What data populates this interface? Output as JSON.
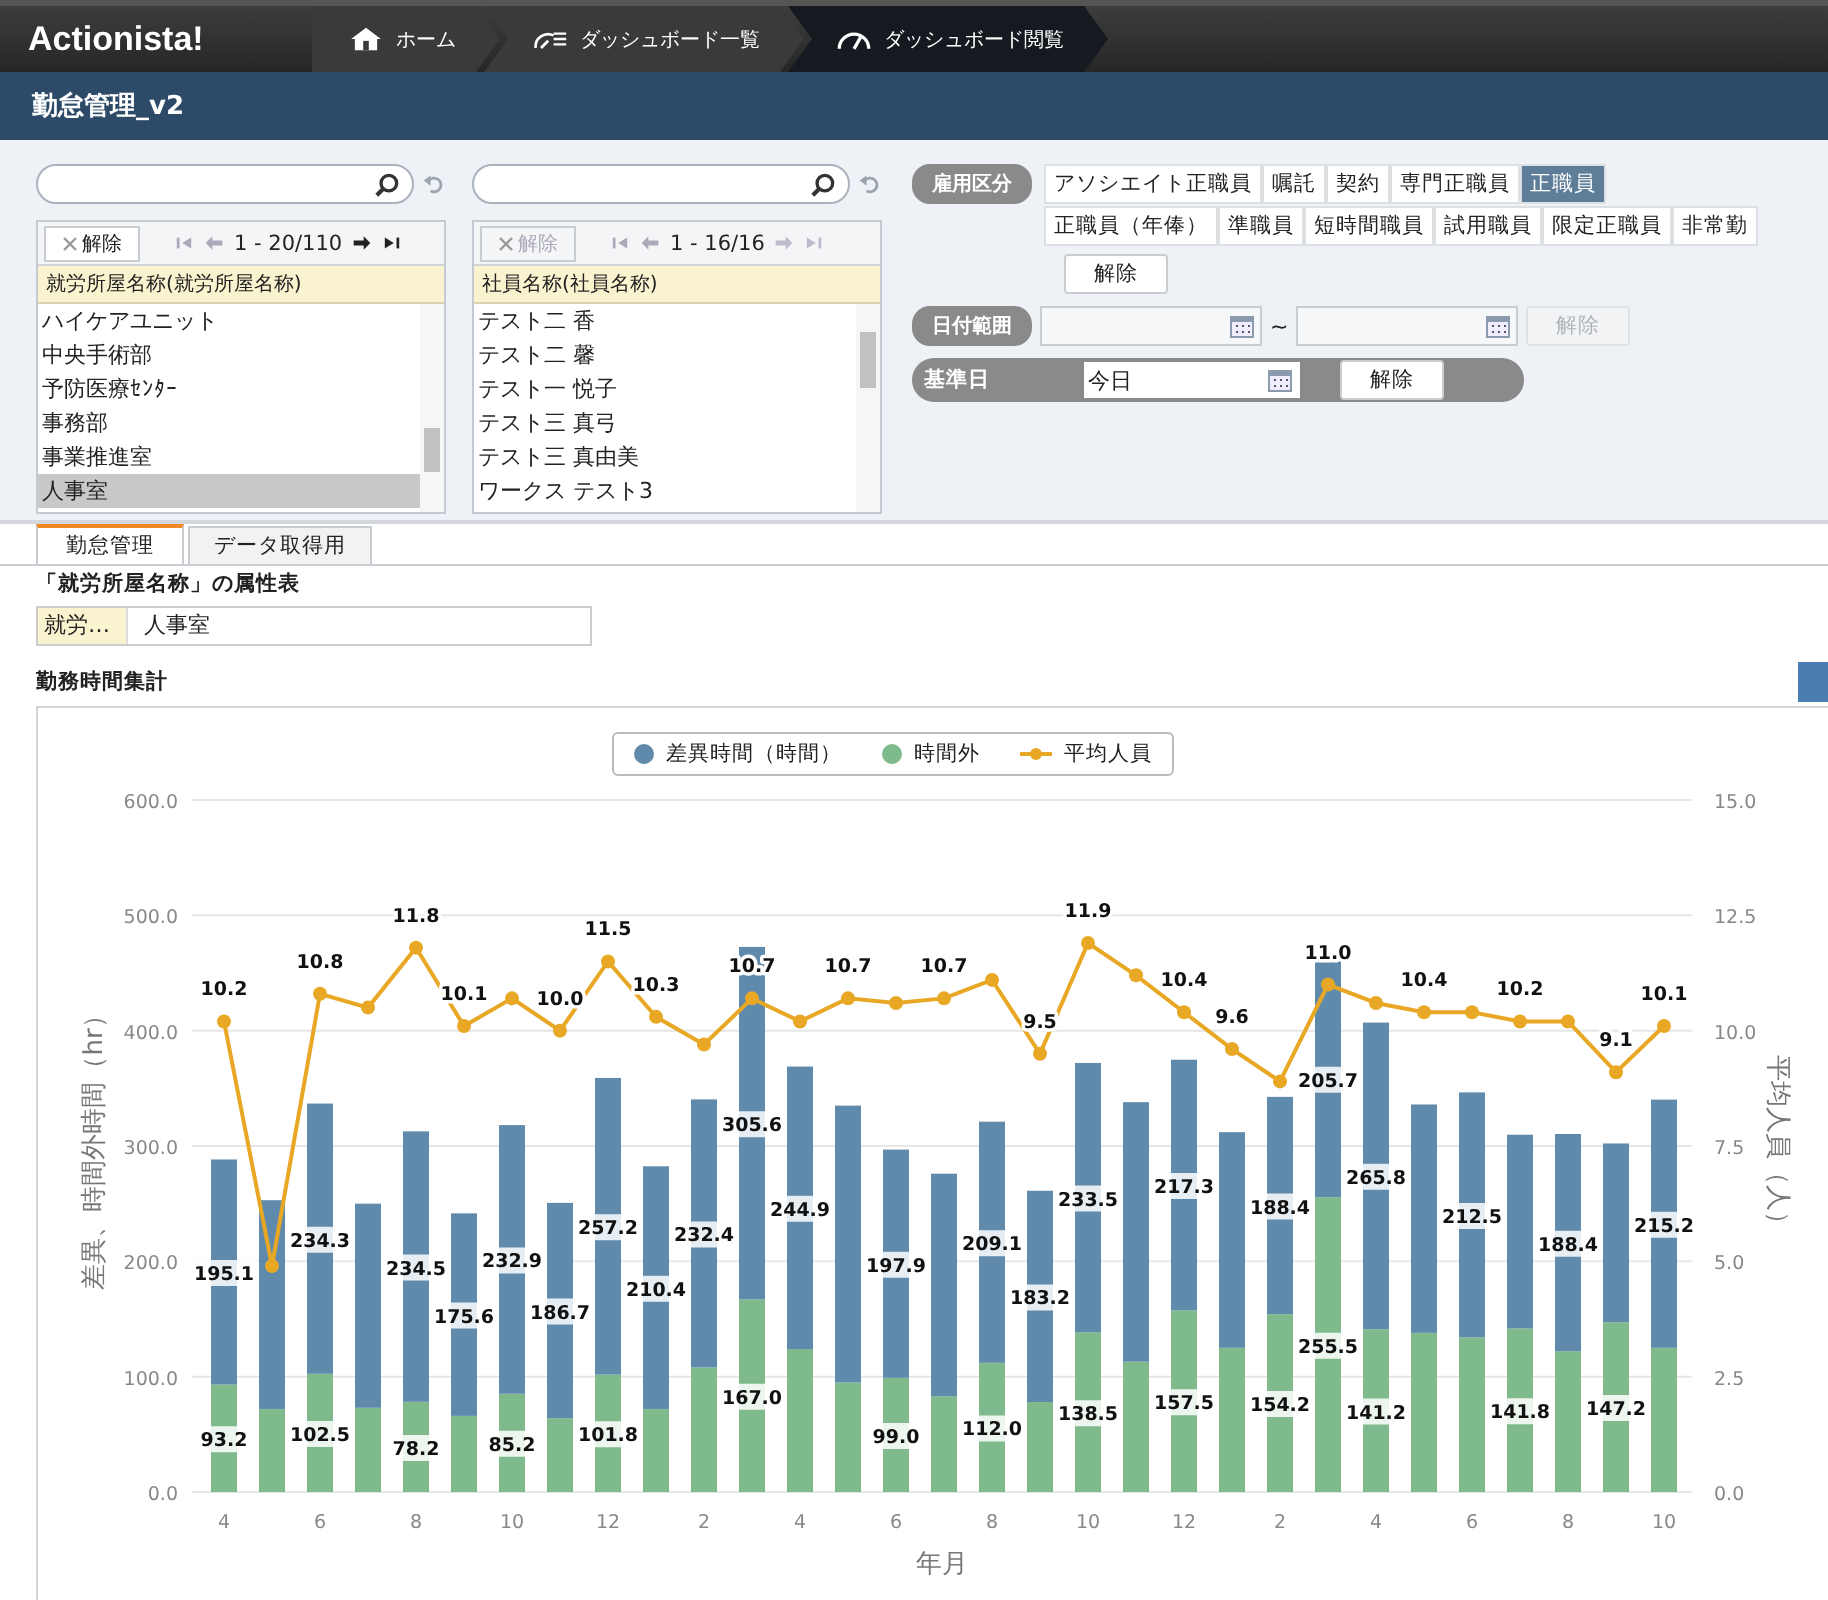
{
  "top_bar": {
    "logo": "Actionista!",
    "breadcrumbs": [
      {
        "label": "ホーム",
        "selected": false
      },
      {
        "label": "ダッシュボード一覧",
        "selected": false
      },
      {
        "label": "ダッシュボード閲覧",
        "selected": true
      }
    ]
  },
  "page_title": "勤怠管理_v2",
  "filters": {
    "lists": [
      {
        "clear": {
          "label": "解除",
          "disabled": false
        },
        "pager": "1 - 20/110",
        "header": "就労所屋名称(就労所屋名称)",
        "items": [
          {
            "label": "ハイケアユニット",
            "selected": false
          },
          {
            "label": "中央手術部",
            "selected": false
          },
          {
            "label": "予防医療ｾﾝﾀｰ",
            "selected": false
          },
          {
            "label": "事務部",
            "selected": false
          },
          {
            "label": "事業推進室",
            "selected": false
          },
          {
            "label": "人事室",
            "selected": true
          }
        ]
      },
      {
        "clear": {
          "label": "解除",
          "disabled": true
        },
        "pager": "1 - 16/16",
        "header": "社員名称(社員名称)",
        "items": [
          {
            "label": "テスト二 香",
            "selected": false
          },
          {
            "label": "テスト二 馨",
            "selected": false
          },
          {
            "label": "テスト一 悦子",
            "selected": false
          },
          {
            "label": "テスト三 真弓",
            "selected": false
          },
          {
            "label": "テスト三 真由美",
            "selected": false
          },
          {
            "label": "ワークス テスト3",
            "selected": false
          }
        ]
      }
    ],
    "employment": {
      "label": "雇用区分",
      "rows": [
        [
          {
            "label": "アソシエイト正職員",
            "selected": false
          },
          {
            "label": "嘱託",
            "selected": false
          },
          {
            "label": "契約",
            "selected": false
          },
          {
            "label": "専門正職員",
            "selected": false
          },
          {
            "label": "正職員",
            "selected": true
          }
        ],
        [
          {
            "label": "正職員（年俸）",
            "selected": false
          },
          {
            "label": "準職員",
            "selected": false
          },
          {
            "label": "短時間職員",
            "selected": false
          },
          {
            "label": "試用職員",
            "selected": false
          },
          {
            "label": "限定正職員",
            "selected": false
          },
          {
            "label": "非常勤",
            "selected": false
          }
        ]
      ],
      "clear": {
        "label": "解除",
        "disabled": false
      }
    },
    "date_range": {
      "label": "日付範囲",
      "separator": "~",
      "clear": {
        "label": "解除",
        "disabled": true
      }
    },
    "base_date": {
      "label": "基準日",
      "value": "今日",
      "clear": {
        "label": "解除",
        "disabled": false
      }
    }
  },
  "tabs": [
    {
      "label": "勤怠管理",
      "selected": true
    },
    {
      "label": "データ取得用",
      "selected": false
    }
  ],
  "attribute_table": {
    "title": "「就労所屋名称」の属性表",
    "key": "就労…",
    "value": "人事室"
  },
  "chart_panel": {
    "title": "勤務時間集計",
    "chart_data": {
      "type": "bar",
      "stacked": true,
      "grid": true,
      "legend": "top",
      "xlabel": "年月",
      "ylabel": "差異、時間外時間（hr）",
      "y2label": "平均人員（人）",
      "ylim": [
        0,
        600
      ],
      "y2lim": [
        0,
        15
      ],
      "yticks": [
        {
          "value": 0,
          "label": "0.0"
        },
        {
          "value": 100,
          "label": "100.0"
        },
        {
          "value": 200,
          "label": "200.0"
        },
        {
          "value": 300,
          "label": "300.0"
        },
        {
          "value": 400,
          "label": "400.0"
        },
        {
          "value": 500,
          "label": "500.0"
        },
        {
          "value": 600,
          "label": "600.0"
        }
      ],
      "y2ticks": [
        {
          "value": 0,
          "label": "0.0"
        },
        {
          "value": 2.5,
          "label": "2.5"
        },
        {
          "value": 5,
          "label": "5.0"
        },
        {
          "value": 7.5,
          "label": "7.5"
        },
        {
          "value": 10,
          "label": "10.0"
        },
        {
          "value": 12.5,
          "label": "12.5"
        },
        {
          "value": 15,
          "label": "15.0"
        }
      ],
      "categories": [
        "4",
        null,
        "6",
        null,
        "8",
        null,
        "10",
        null,
        "12",
        null,
        "2",
        null,
        "4",
        null,
        "6",
        null,
        "8",
        null,
        "10",
        null,
        "12",
        null,
        "2",
        null,
        "4",
        null,
        "6",
        null,
        "8",
        null,
        "10"
      ],
      "series": [
        {
          "name": "差異時間（時間）",
          "type": "bar",
          "color": "#5f8aab",
          "values": [
            195.1,
            181,
            234.3,
            177,
            234.5,
            175.6,
            232.9,
            186.7,
            257.2,
            210.4,
            232.4,
            305.6,
            244.9,
            240,
            197.9,
            193,
            209.1,
            183.2,
            233.5,
            225,
            217.3,
            187,
            188.4,
            205.7,
            265.8,
            198,
            212.5,
            168,
            188.4,
            155,
            215.2
          ],
          "value_labels": [
            "195.1",
            null,
            "234.3",
            null,
            "234.5",
            "175.6",
            "232.9",
            "186.7",
            "257.2",
            "210.4",
            "232.4",
            "305.6",
            "244.9",
            null,
            "197.9",
            null,
            "209.1",
            "183.2",
            "233.5",
            null,
            "217.3",
            null,
            "188.4",
            "205.7",
            "265.8",
            null,
            "212.5",
            null,
            "188.4",
            null,
            "215.2"
          ]
        },
        {
          "name": "時間外",
          "type": "bar",
          "color": "#7fba8c",
          "values": [
            93.2,
            72,
            102.5,
            73,
            78.2,
            66,
            85.2,
            64,
            101.8,
            72,
            108,
            167.0,
            124,
            95,
            99.0,
            83,
            112.0,
            78,
            138.5,
            113,
            157.5,
            125,
            154.2,
            255.5,
            141.2,
            138,
            134,
            141.8,
            122,
            147.2,
            125
          ],
          "value_labels": [
            "93.2",
            null,
            "102.5",
            null,
            "78.2",
            null,
            "85.2",
            null,
            "101.8",
            null,
            null,
            "167.0",
            null,
            null,
            "99.0",
            null,
            "112.0",
            null,
            "138.5",
            null,
            "157.5",
            null,
            "154.2",
            "255.5",
            "141.2",
            null,
            null,
            "141.8",
            null,
            "147.2",
            null
          ]
        },
        {
          "name": "平均人員",
          "type": "line",
          "axis": "y2",
          "marker": "circle",
          "color": "#e8a825",
          "values": [
            10.2,
            4.9,
            10.8,
            10.5,
            11.8,
            10.1,
            10.7,
            10.0,
            11.5,
            10.3,
            9.7,
            10.7,
            10.2,
            10.7,
            10.6,
            10.7,
            11.1,
            9.5,
            11.9,
            11.2,
            10.4,
            9.6,
            8.9,
            11.0,
            10.6,
            10.4,
            10.4,
            10.2,
            10.2,
            9.1,
            10.1
          ],
          "value_labels": [
            "10.2",
            null,
            "10.8",
            null,
            "11.8",
            "10.1",
            null,
            "10.0",
            "11.5",
            "10.3",
            null,
            "10.7",
            null,
            "10.7",
            null,
            "10.7",
            null,
            "9.5",
            "11.9",
            null,
            "10.4",
            "9.6",
            null,
            "11.0",
            null,
            "10.4",
            null,
            "10.2",
            null,
            "9.1",
            "10.1"
          ]
        }
      ]
    }
  }
}
